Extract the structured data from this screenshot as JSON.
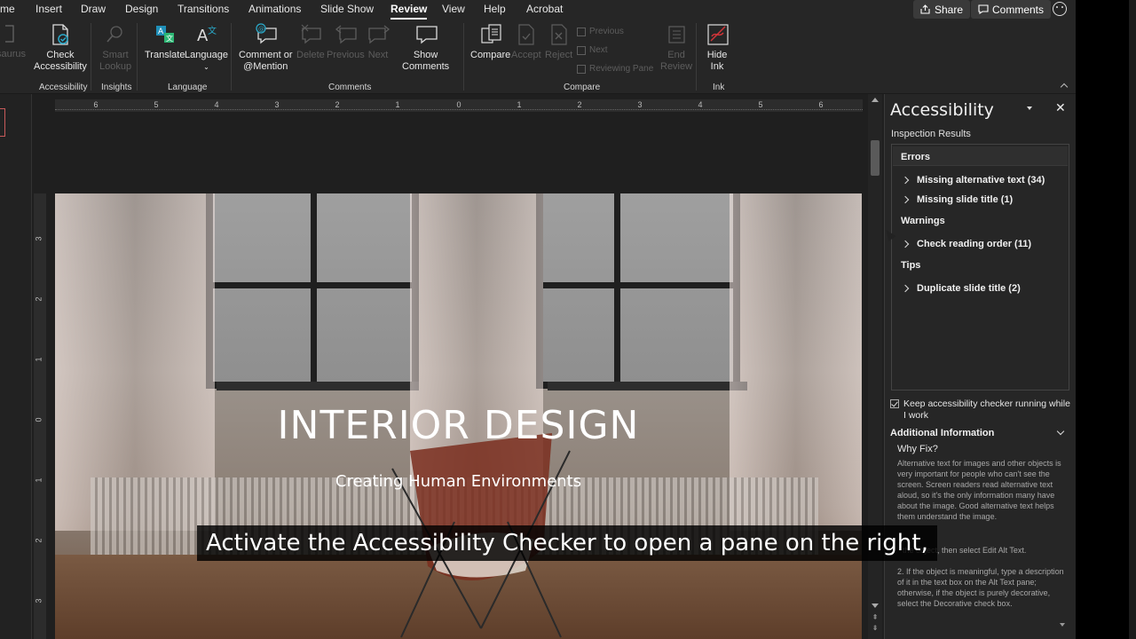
{
  "menu": {
    "tabs": [
      {
        "label": "me"
      },
      {
        "label": "Insert"
      },
      {
        "label": "Draw"
      },
      {
        "label": "Design"
      },
      {
        "label": "Transitions"
      },
      {
        "label": "Animations"
      },
      {
        "label": "Slide Show"
      },
      {
        "label": "Review"
      },
      {
        "label": "View"
      },
      {
        "label": "Help"
      },
      {
        "label": "Acrobat"
      }
    ],
    "active_tab": "Review",
    "share_label": "Share",
    "comments_label": "Comments"
  },
  "ribbon": {
    "partial_label": "saurus",
    "check_accessibility": [
      "Check",
      "Accessibility"
    ],
    "smart_lookup": [
      "Smart",
      "Lookup"
    ],
    "translate": "Translate",
    "language": "Language",
    "comment_mention": [
      "Comment or",
      "@Mention"
    ],
    "delete": "Delete",
    "previous": "Previous",
    "next": "Next",
    "show_comments": [
      "Show",
      "Comments"
    ],
    "compare": "Compare",
    "accept": "Accept",
    "reject": "Reject",
    "compare_previous": "Previous",
    "compare_next": "Next",
    "reviewing_pane": "Reviewing Pane",
    "end_review": [
      "End",
      "Review"
    ],
    "hide_ink": [
      "Hide",
      "Ink"
    ],
    "groups": {
      "accessibility": "Accessibility",
      "insights": "Insights",
      "language": "Language",
      "comments": "Comments",
      "compare": "Compare",
      "ink": "Ink"
    }
  },
  "ruler": {
    "h_ticks": [
      "6",
      "5",
      "4",
      "3",
      "2",
      "1",
      "0",
      "1",
      "2",
      "3",
      "4",
      "5",
      "6"
    ],
    "v_ticks": [
      "3",
      "2",
      "1",
      "0",
      "1",
      "2",
      "3"
    ]
  },
  "slide": {
    "title": "INTERIOR DESIGN",
    "subtitle": "Creating Human Environments"
  },
  "pane": {
    "title": "Accessibility",
    "inspection_results": "Inspection Results",
    "errors_heading": "Errors",
    "errors": [
      "Missing alternative text (34)",
      "Missing slide title (1)"
    ],
    "warnings_heading": "Warnings",
    "warnings": [
      "Check reading order (11)"
    ],
    "tips_heading": "Tips",
    "tips": [
      "Duplicate slide title (2)"
    ],
    "keep_running": "Keep accessibility checker running while I work",
    "keep_running_checked": true,
    "additional_info": "Additional Information",
    "why_fix": "Why Fix?",
    "why_fix_text": "Alternative text for images and other objects is very important for people who can't see the screen. Screen readers read alternative text aloud, so it's the only information many have about the image. Good alternative text helps them understand the image.",
    "step1_text": "the object, then select Edit Alt Text.",
    "step2_text": "2. If the object is meaningful, type a description of it in the text box on the Alt Text pane; otherwise, if the object is purely decorative, select the Decorative check box."
  },
  "caption": "Activate the Accessibility Checker to open a pane on the right,",
  "colors": {
    "ribbon_bg": "#262626",
    "workspace_bg": "#1f1f1f",
    "pane_bg": "#262626",
    "accent_teal": "#2aa9c9",
    "accent_red": "#d13438"
  }
}
